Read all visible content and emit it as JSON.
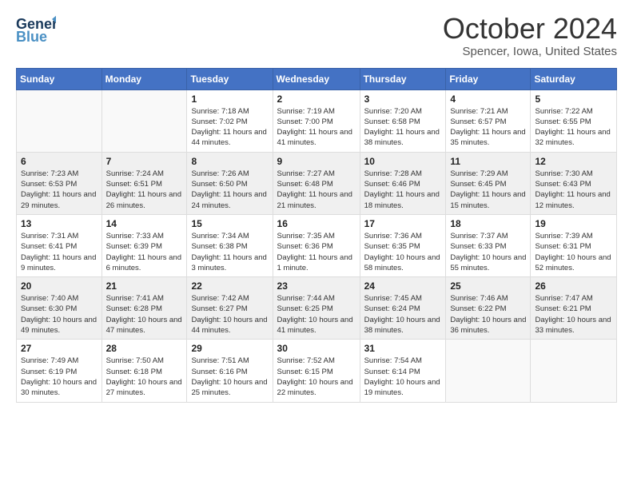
{
  "logo": {
    "line1": "General",
    "line2": "Blue"
  },
  "header": {
    "month": "October 2024",
    "location": "Spencer, Iowa, United States"
  },
  "days_of_week": [
    "Sunday",
    "Monday",
    "Tuesday",
    "Wednesday",
    "Thursday",
    "Friday",
    "Saturday"
  ],
  "weeks": [
    [
      {
        "day": "",
        "sunrise": "",
        "sunset": "",
        "daylight": ""
      },
      {
        "day": "",
        "sunrise": "",
        "sunset": "",
        "daylight": ""
      },
      {
        "day": "1",
        "sunrise": "Sunrise: 7:18 AM",
        "sunset": "Sunset: 7:02 PM",
        "daylight": "Daylight: 11 hours and 44 minutes."
      },
      {
        "day": "2",
        "sunrise": "Sunrise: 7:19 AM",
        "sunset": "Sunset: 7:00 PM",
        "daylight": "Daylight: 11 hours and 41 minutes."
      },
      {
        "day": "3",
        "sunrise": "Sunrise: 7:20 AM",
        "sunset": "Sunset: 6:58 PM",
        "daylight": "Daylight: 11 hours and 38 minutes."
      },
      {
        "day": "4",
        "sunrise": "Sunrise: 7:21 AM",
        "sunset": "Sunset: 6:57 PM",
        "daylight": "Daylight: 11 hours and 35 minutes."
      },
      {
        "day": "5",
        "sunrise": "Sunrise: 7:22 AM",
        "sunset": "Sunset: 6:55 PM",
        "daylight": "Daylight: 11 hours and 32 minutes."
      }
    ],
    [
      {
        "day": "6",
        "sunrise": "Sunrise: 7:23 AM",
        "sunset": "Sunset: 6:53 PM",
        "daylight": "Daylight: 11 hours and 29 minutes."
      },
      {
        "day": "7",
        "sunrise": "Sunrise: 7:24 AM",
        "sunset": "Sunset: 6:51 PM",
        "daylight": "Daylight: 11 hours and 26 minutes."
      },
      {
        "day": "8",
        "sunrise": "Sunrise: 7:26 AM",
        "sunset": "Sunset: 6:50 PM",
        "daylight": "Daylight: 11 hours and 24 minutes."
      },
      {
        "day": "9",
        "sunrise": "Sunrise: 7:27 AM",
        "sunset": "Sunset: 6:48 PM",
        "daylight": "Daylight: 11 hours and 21 minutes."
      },
      {
        "day": "10",
        "sunrise": "Sunrise: 7:28 AM",
        "sunset": "Sunset: 6:46 PM",
        "daylight": "Daylight: 11 hours and 18 minutes."
      },
      {
        "day": "11",
        "sunrise": "Sunrise: 7:29 AM",
        "sunset": "Sunset: 6:45 PM",
        "daylight": "Daylight: 11 hours and 15 minutes."
      },
      {
        "day": "12",
        "sunrise": "Sunrise: 7:30 AM",
        "sunset": "Sunset: 6:43 PM",
        "daylight": "Daylight: 11 hours and 12 minutes."
      }
    ],
    [
      {
        "day": "13",
        "sunrise": "Sunrise: 7:31 AM",
        "sunset": "Sunset: 6:41 PM",
        "daylight": "Daylight: 11 hours and 9 minutes."
      },
      {
        "day": "14",
        "sunrise": "Sunrise: 7:33 AM",
        "sunset": "Sunset: 6:39 PM",
        "daylight": "Daylight: 11 hours and 6 minutes."
      },
      {
        "day": "15",
        "sunrise": "Sunrise: 7:34 AM",
        "sunset": "Sunset: 6:38 PM",
        "daylight": "Daylight: 11 hours and 3 minutes."
      },
      {
        "day": "16",
        "sunrise": "Sunrise: 7:35 AM",
        "sunset": "Sunset: 6:36 PM",
        "daylight": "Daylight: 11 hours and 1 minute."
      },
      {
        "day": "17",
        "sunrise": "Sunrise: 7:36 AM",
        "sunset": "Sunset: 6:35 PM",
        "daylight": "Daylight: 10 hours and 58 minutes."
      },
      {
        "day": "18",
        "sunrise": "Sunrise: 7:37 AM",
        "sunset": "Sunset: 6:33 PM",
        "daylight": "Daylight: 10 hours and 55 minutes."
      },
      {
        "day": "19",
        "sunrise": "Sunrise: 7:39 AM",
        "sunset": "Sunset: 6:31 PM",
        "daylight": "Daylight: 10 hours and 52 minutes."
      }
    ],
    [
      {
        "day": "20",
        "sunrise": "Sunrise: 7:40 AM",
        "sunset": "Sunset: 6:30 PM",
        "daylight": "Daylight: 10 hours and 49 minutes."
      },
      {
        "day": "21",
        "sunrise": "Sunrise: 7:41 AM",
        "sunset": "Sunset: 6:28 PM",
        "daylight": "Daylight: 10 hours and 47 minutes."
      },
      {
        "day": "22",
        "sunrise": "Sunrise: 7:42 AM",
        "sunset": "Sunset: 6:27 PM",
        "daylight": "Daylight: 10 hours and 44 minutes."
      },
      {
        "day": "23",
        "sunrise": "Sunrise: 7:44 AM",
        "sunset": "Sunset: 6:25 PM",
        "daylight": "Daylight: 10 hours and 41 minutes."
      },
      {
        "day": "24",
        "sunrise": "Sunrise: 7:45 AM",
        "sunset": "Sunset: 6:24 PM",
        "daylight": "Daylight: 10 hours and 38 minutes."
      },
      {
        "day": "25",
        "sunrise": "Sunrise: 7:46 AM",
        "sunset": "Sunset: 6:22 PM",
        "daylight": "Daylight: 10 hours and 36 minutes."
      },
      {
        "day": "26",
        "sunrise": "Sunrise: 7:47 AM",
        "sunset": "Sunset: 6:21 PM",
        "daylight": "Daylight: 10 hours and 33 minutes."
      }
    ],
    [
      {
        "day": "27",
        "sunrise": "Sunrise: 7:49 AM",
        "sunset": "Sunset: 6:19 PM",
        "daylight": "Daylight: 10 hours and 30 minutes."
      },
      {
        "day": "28",
        "sunrise": "Sunrise: 7:50 AM",
        "sunset": "Sunset: 6:18 PM",
        "daylight": "Daylight: 10 hours and 27 minutes."
      },
      {
        "day": "29",
        "sunrise": "Sunrise: 7:51 AM",
        "sunset": "Sunset: 6:16 PM",
        "daylight": "Daylight: 10 hours and 25 minutes."
      },
      {
        "day": "30",
        "sunrise": "Sunrise: 7:52 AM",
        "sunset": "Sunset: 6:15 PM",
        "daylight": "Daylight: 10 hours and 22 minutes."
      },
      {
        "day": "31",
        "sunrise": "Sunrise: 7:54 AM",
        "sunset": "Sunset: 6:14 PM",
        "daylight": "Daylight: 10 hours and 19 minutes."
      },
      {
        "day": "",
        "sunrise": "",
        "sunset": "",
        "daylight": ""
      },
      {
        "day": "",
        "sunrise": "",
        "sunset": "",
        "daylight": ""
      }
    ]
  ]
}
